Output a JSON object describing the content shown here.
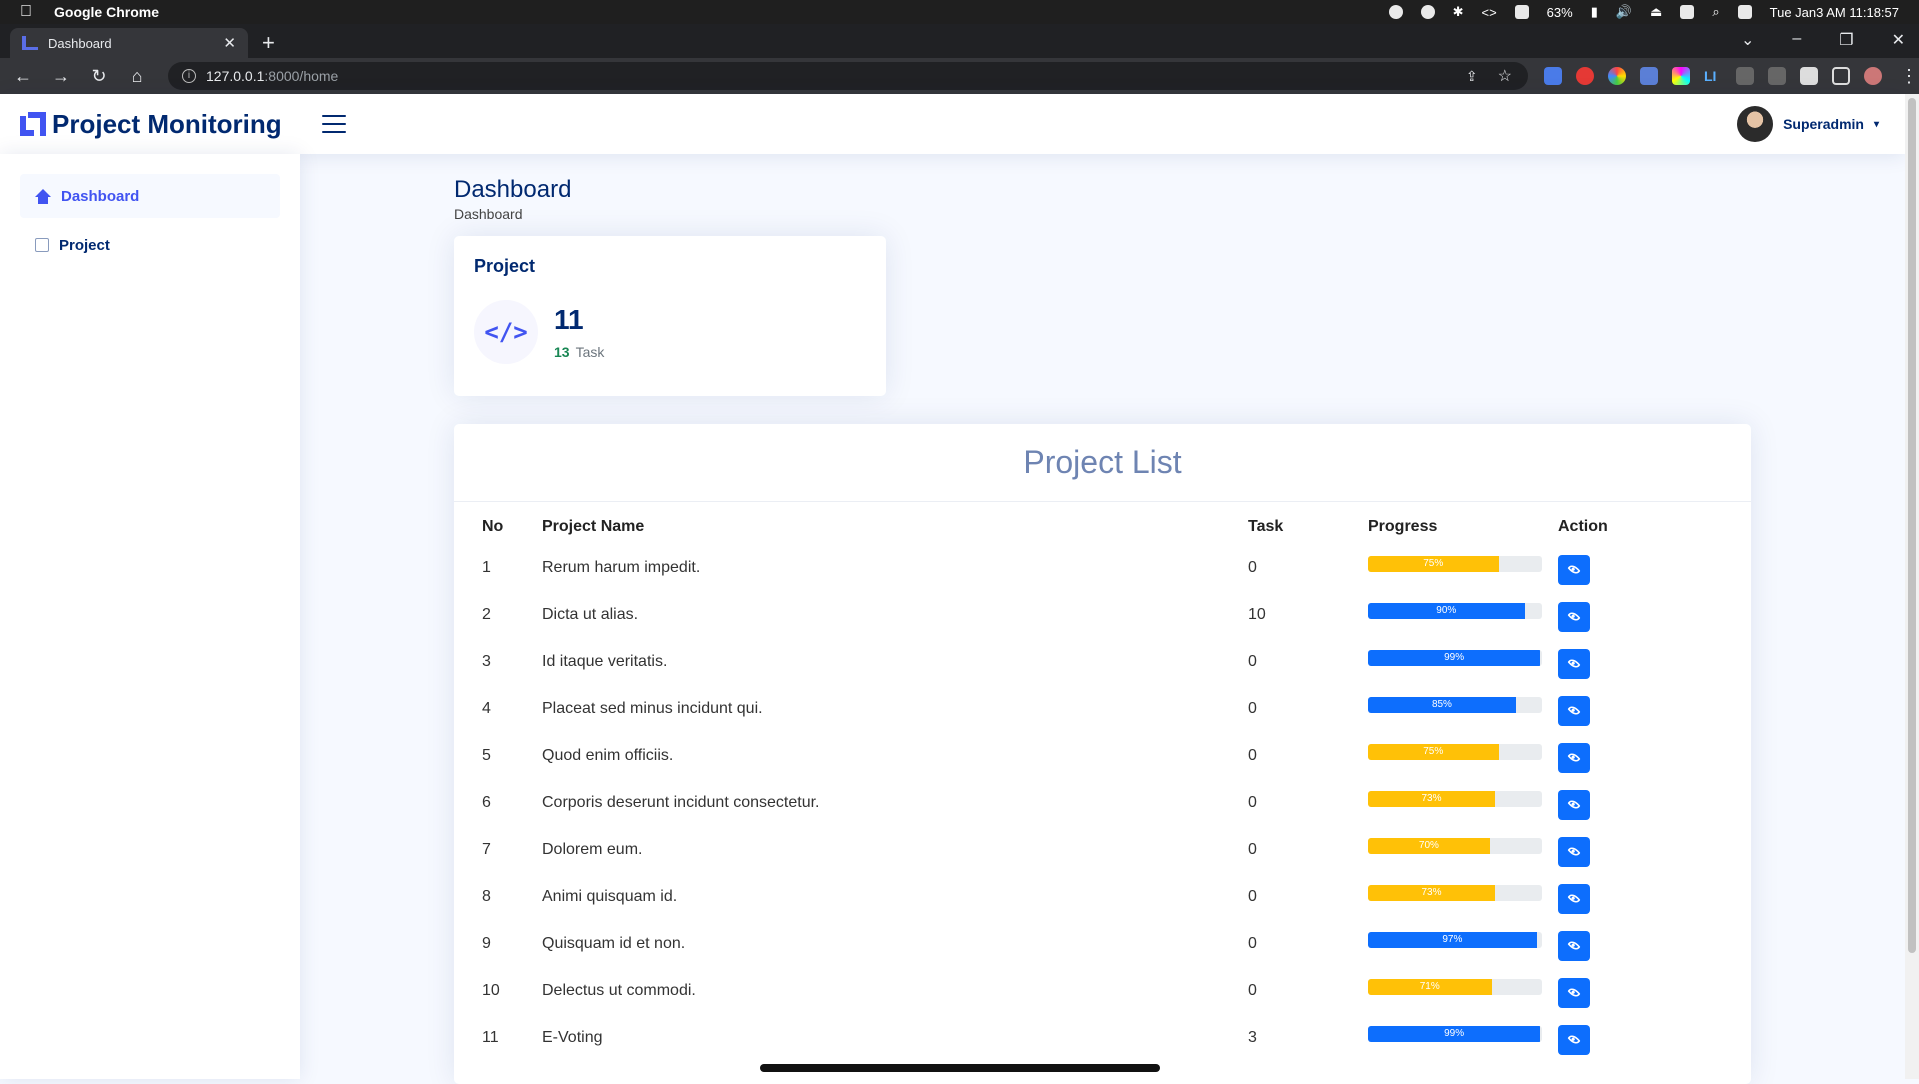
{
  "mac": {
    "app_name": "Google Chrome",
    "battery": "63%",
    "clock": "Tue Jan3 AM 11:18:57"
  },
  "browser": {
    "tab_title": "Dashboard",
    "url_host": "127.0.0.1",
    "url_path": ":8000/home"
  },
  "header": {
    "brand": "Project Monitoring",
    "user_name": "Superadmin"
  },
  "sidebar": {
    "items": [
      {
        "label": "Dashboard",
        "icon": "house-icon",
        "active": true
      },
      {
        "label": "Project",
        "icon": "file-code-icon",
        "active": false
      }
    ]
  },
  "page": {
    "title": "Dashboard",
    "breadcrumb": "Dashboard"
  },
  "project_card": {
    "title": "Project",
    "icon": "code-icon",
    "count": "11",
    "task_count": "13",
    "task_label": "Task"
  },
  "project_list": {
    "title": "Project List",
    "columns": [
      "No",
      "Project Name",
      "Task",
      "Progress",
      "Action"
    ],
    "rows": [
      {
        "no": "1",
        "name": "Rerum harum impedit.",
        "task": "0",
        "progress": 75,
        "label": "75%"
      },
      {
        "no": "2",
        "name": "Dicta ut alias.",
        "task": "10",
        "progress": 90,
        "label": "90%"
      },
      {
        "no": "3",
        "name": "Id itaque veritatis.",
        "task": "0",
        "progress": 99,
        "label": "99%"
      },
      {
        "no": "4",
        "name": "Placeat sed minus incidunt qui.",
        "task": "0",
        "progress": 85,
        "label": "85%"
      },
      {
        "no": "5",
        "name": "Quod enim officiis.",
        "task": "0",
        "progress": 75,
        "label": "75%"
      },
      {
        "no": "6",
        "name": "Corporis deserunt incidunt consectetur.",
        "task": "0",
        "progress": 73,
        "label": "73%"
      },
      {
        "no": "7",
        "name": "Dolorem eum.",
        "task": "0",
        "progress": 70,
        "label": "70%"
      },
      {
        "no": "8",
        "name": "Animi quisquam id.",
        "task": "0",
        "progress": 73,
        "label": "73%"
      },
      {
        "no": "9",
        "name": "Quisquam id et non.",
        "task": "0",
        "progress": 97,
        "label": "97%"
      },
      {
        "no": "10",
        "name": "Delectus ut commodi.",
        "task": "0",
        "progress": 71,
        "label": "71%"
      },
      {
        "no": "11",
        "name": "E-Voting",
        "task": "3",
        "progress": 99,
        "label": "99%"
      }
    ],
    "action_icon": "eye-icon"
  },
  "colors": {
    "brand": "#4154f1",
    "navy": "#012970",
    "progress_high": "#0d6efd",
    "progress_mid": "#ffc107"
  }
}
